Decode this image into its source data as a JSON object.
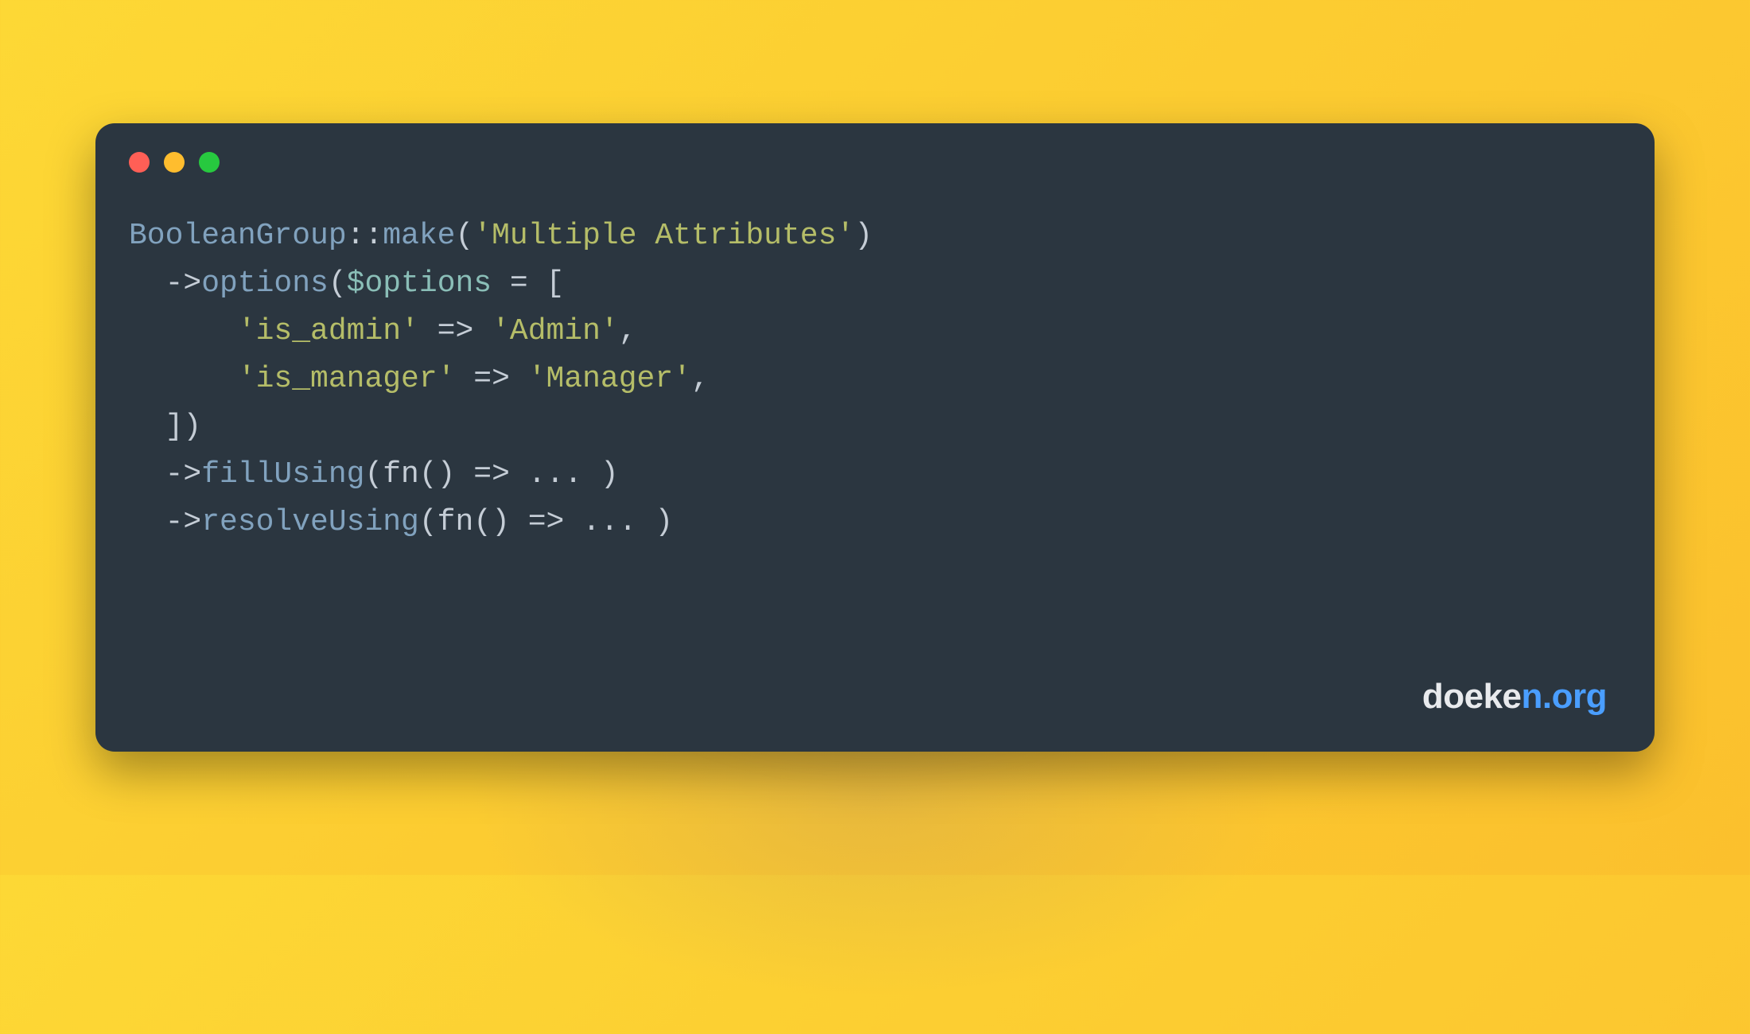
{
  "code": {
    "class": "BooleanGroup",
    "scope": "::",
    "make": "make",
    "make_arg": "'Multiple Attributes'",
    "arrow": "->",
    "options_method": "options",
    "options_var": "$options",
    "eq": " = [",
    "opt1_key": "'is_admin'",
    "opt1_arrow": " => ",
    "opt1_val": "'Admin'",
    "opt2_key": "'is_manager'",
    "opt2_arrow": " => ",
    "opt2_val": "'Manager'",
    "close_arr": "])",
    "fillUsing": "fillUsing",
    "fn1": "(fn() => ... )",
    "resolveUsing": "resolveUsing",
    "fn2": "(fn() => ... )",
    "comma": ",",
    "lparen": "(",
    "rparen": ")"
  },
  "watermark": {
    "part1": "doeke",
    "part2": "n.org"
  },
  "colors": {
    "bg": "#2b3640",
    "class": "#81a2be",
    "string": "#b5bd68",
    "var": "#8abeb7",
    "default": "#c5cdd6",
    "dot_red": "#ff5f56",
    "dot_yellow": "#ffbd2e",
    "dot_green": "#27c93f"
  }
}
